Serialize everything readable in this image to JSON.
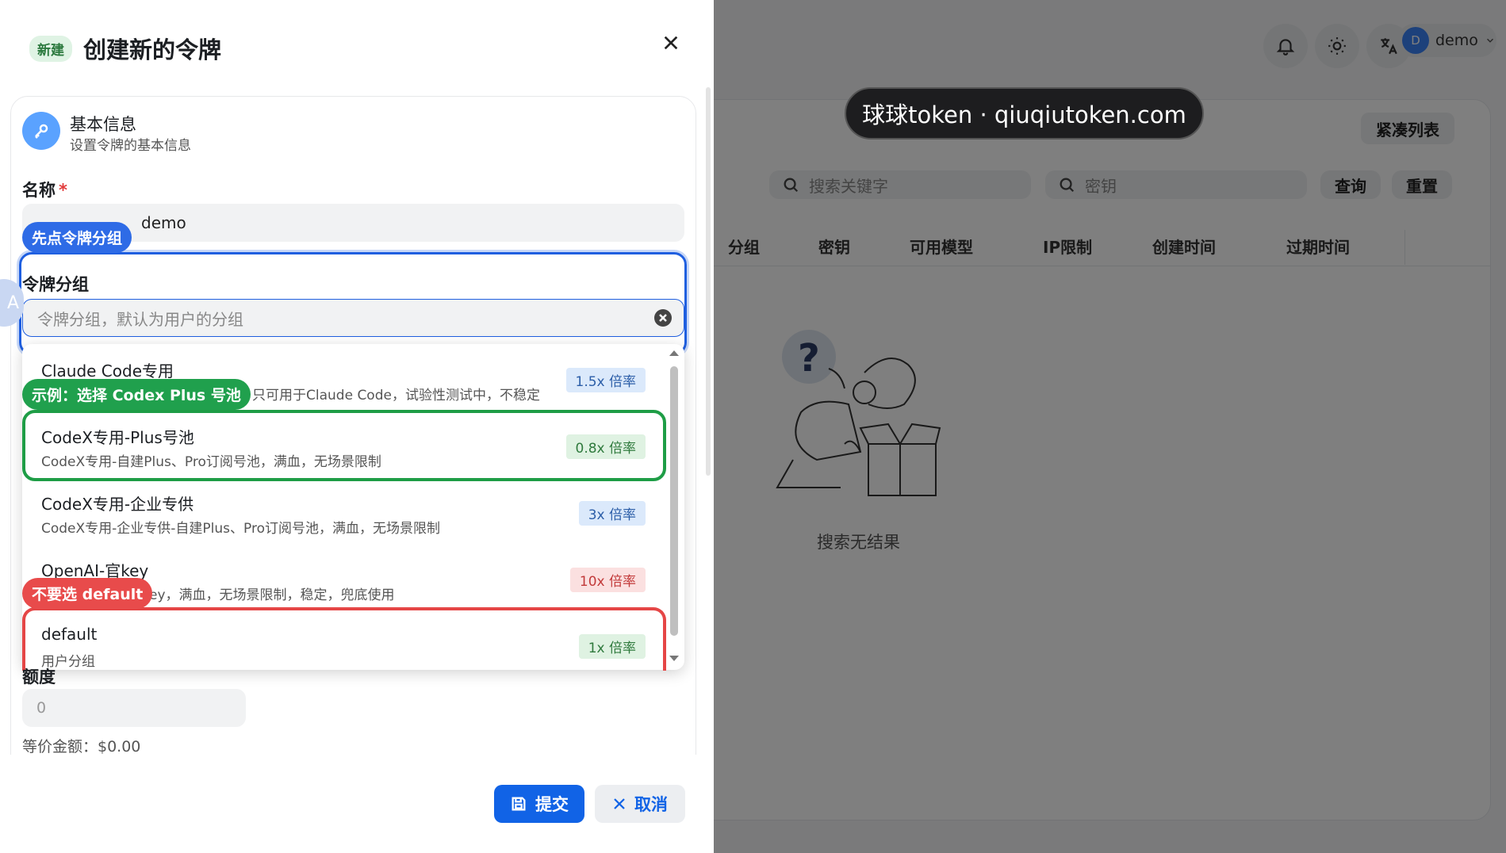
{
  "watermark": "球球token · qiuqiutoken.com",
  "header": {
    "username": "demo",
    "avatar_letter": "D"
  },
  "table": {
    "compact_label": "紧凑列表",
    "search_placeholder": "搜索关键字",
    "key_placeholder": "密钥",
    "query_label": "查询",
    "reset_label": "重置",
    "columns": [
      "分组",
      "密钥",
      "可用模型",
      "IP限制",
      "创建时间",
      "过期时间"
    ],
    "empty_text": "搜索无结果"
  },
  "sheet": {
    "tag": "新建",
    "title": "创建新的令牌",
    "section_title": "基本信息",
    "section_subtitle": "设置令牌的基本信息",
    "name_label": "名称",
    "name_required": "*",
    "name_value": "demo",
    "group_label": "令牌分组",
    "group_placeholder": "令牌分组，默认为用户的分组",
    "quota_label": "额度",
    "quota_placeholder": "0",
    "equiv_amount": "等价金额：$0.00",
    "submit_label": "提交",
    "cancel_label": "取消"
  },
  "dropdown": {
    "options": [
      {
        "title": "Claude Code专用",
        "desc": "只可用于Claude Code，试验性测试中，不稳定",
        "badge": "1.5x 倍率",
        "badge_color": "blue"
      },
      {
        "title": "CodeX专用-Plus号池",
        "desc": "CodeX专用-自建Plus、Pro订阅号池，满血，无场景限制",
        "badge": "0.8x 倍率",
        "badge_color": "green"
      },
      {
        "title": "CodeX专用-企业专供",
        "desc": "CodeX专用-企业专供-自建Plus、Pro订阅号池，满血，无场景限制",
        "badge": "3x 倍率",
        "badge_color": "blue"
      },
      {
        "title": "OpenAI-官key",
        "desc": "ey，满血，无场景限制，稳定，兜底使用",
        "badge": "10x 倍率",
        "badge_color": "red"
      },
      {
        "title": "default",
        "desc": "用户分组",
        "badge": "1x 倍率",
        "badge_color": "green"
      }
    ]
  },
  "annotations": {
    "step1": "先点令牌分组",
    "example": "示例：选择 Codex Plus 号池",
    "warning": "不要选 default"
  },
  "colors": {
    "primary": "#1163e6",
    "highlight_green": "#1e9d46",
    "highlight_red": "#e54646",
    "highlight_blue": "#1f5fe0"
  }
}
